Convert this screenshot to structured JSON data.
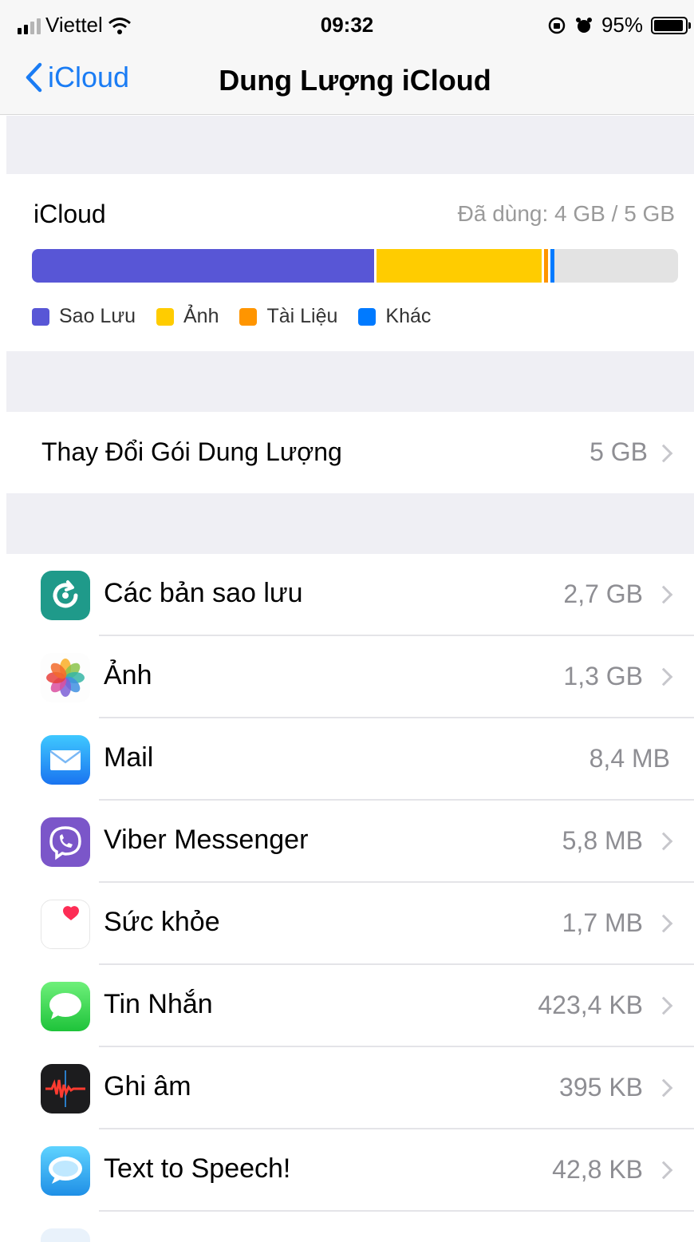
{
  "status_bar": {
    "carrier": "Viettel",
    "time": "09:32",
    "battery_percent": "95%",
    "battery_level": 0.95
  },
  "nav": {
    "back_label": "iCloud",
    "title": "Dung Lượng iCloud"
  },
  "storage": {
    "label": "iCloud",
    "used_text": "Đã dùng: 4 GB / 5 GB",
    "segments": [
      {
        "name": "Sao Lưu",
        "fraction": 0.53,
        "color": "#5856d6"
      },
      {
        "name": "Ảnh",
        "fraction": 0.255,
        "color": "#ffcc00"
      },
      {
        "name": "Tài Liệu",
        "fraction": 0.006,
        "color": "#ff9500"
      },
      {
        "name": "Khác",
        "fraction": 0.006,
        "color": "#007aff"
      }
    ],
    "legend": [
      {
        "label": "Sao Lưu",
        "color": "#5856d6"
      },
      {
        "label": "Ảnh",
        "color": "#ffcc00"
      },
      {
        "label": "Tài Liệu",
        "color": "#ff9500"
      },
      {
        "label": "Khác",
        "color": "#007aff"
      }
    ]
  },
  "plan": {
    "label": "Thay Đổi Gói Dung Lượng",
    "value": "5 GB"
  },
  "apps": [
    {
      "name": "Các bản sao lưu",
      "size": "2,7 GB",
      "icon": "backup-icon",
      "chevron": true
    },
    {
      "name": "Ảnh",
      "size": "1,3 GB",
      "icon": "photos-icon",
      "chevron": true
    },
    {
      "name": "Mail",
      "size": "8,4 MB",
      "icon": "mail-icon",
      "chevron": false
    },
    {
      "name": "Viber Messenger",
      "size": "5,8 MB",
      "icon": "viber-icon",
      "chevron": true
    },
    {
      "name": "Sức khỏe",
      "size": "1,7 MB",
      "icon": "health-icon",
      "chevron": true
    },
    {
      "name": "Tin Nhắn",
      "size": "423,4 KB",
      "icon": "messages-icon",
      "chevron": true
    },
    {
      "name": "Ghi âm",
      "size": "395 KB",
      "icon": "voice-memos-icon",
      "chevron": true
    },
    {
      "name": "Text to Speech!",
      "size": "42,8 KB",
      "icon": "text-to-speech-icon",
      "chevron": true
    }
  ]
}
